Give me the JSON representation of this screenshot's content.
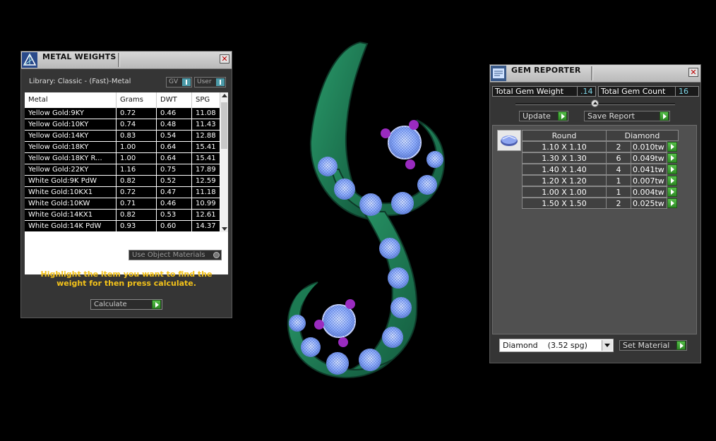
{
  "metal_weights": {
    "title": "METAL WEIGHTS",
    "library_label": "Library: Classic - (Fast)-Metal",
    "combo_gv": "GV",
    "combo_user": "User",
    "columns": [
      "Metal",
      "Grams",
      "DWT",
      "SPG"
    ],
    "rows": [
      [
        "Yellow Gold:9KY",
        "0.72",
        "0.46",
        "11.08"
      ],
      [
        "Yellow Gold:10KY",
        "0.74",
        "0.48",
        "11.43"
      ],
      [
        "Yellow Gold:14KY",
        "0.83",
        "0.54",
        "12.88"
      ],
      [
        "Yellow Gold:18KY",
        "1.00",
        "0.64",
        "15.41"
      ],
      [
        "Yellow Gold:18KY R...",
        "1.00",
        "0.64",
        "15.41"
      ],
      [
        "Yellow Gold:22KY",
        "1.16",
        "0.75",
        "17.89"
      ],
      [
        "White Gold:9K PdW",
        "0.82",
        "0.52",
        "12.59"
      ],
      [
        "White Gold:10KX1",
        "0.72",
        "0.47",
        "11.18"
      ],
      [
        "White Gold:10KW",
        "0.71",
        "0.46",
        "10.99"
      ],
      [
        "White Gold:14KX1",
        "0.82",
        "0.53",
        "12.61"
      ],
      [
        "White Gold:14K PdW",
        "0.93",
        "0.60",
        "14.37"
      ]
    ],
    "use_object_materials": "Use Object Materials",
    "hint": "Highlight the item you want to find the weight for then press calculate.",
    "calculate_label": "Calculate"
  },
  "gem_reporter": {
    "title": "GEM REPORTER",
    "total_weight_label": "Total Gem Weight",
    "total_weight_value": ".14",
    "total_count_label": "Total Gem Count",
    "total_count_value": "16",
    "update_label": "Update",
    "save_report_label": "Save Report",
    "header_shape": "Round",
    "header_material": "Diamond",
    "rows": [
      [
        "1.10 X 1.10",
        "2",
        "0.010tw"
      ],
      [
        "1.30 X 1.30",
        "6",
        "0.049tw"
      ],
      [
        "1.40 X 1.40",
        "4",
        "0.041tw"
      ],
      [
        "1.20 X 1.20",
        "1",
        "0.007tw"
      ],
      [
        "1.00 X 1.00",
        "1",
        "0.004tw"
      ],
      [
        "1.50 X 1.50",
        "2",
        "0.025tw"
      ]
    ],
    "material_select": "Diamond    (3.52 spg)",
    "set_material_label": "Set Material"
  },
  "colors": {
    "accent_yellow": "#f3c21a",
    "value_cyan": "#7fd7e8",
    "button_green": "#3fa835",
    "metal_green": "#1f7a55",
    "gem_blue": "#8fb0ff",
    "gem_purple": "#9a2bc0"
  },
  "icons": {
    "metal_weights": "pyramid-logo-icon",
    "gem_reporter": "gem-report-icon",
    "gem_shape": "round-gem-icon"
  }
}
